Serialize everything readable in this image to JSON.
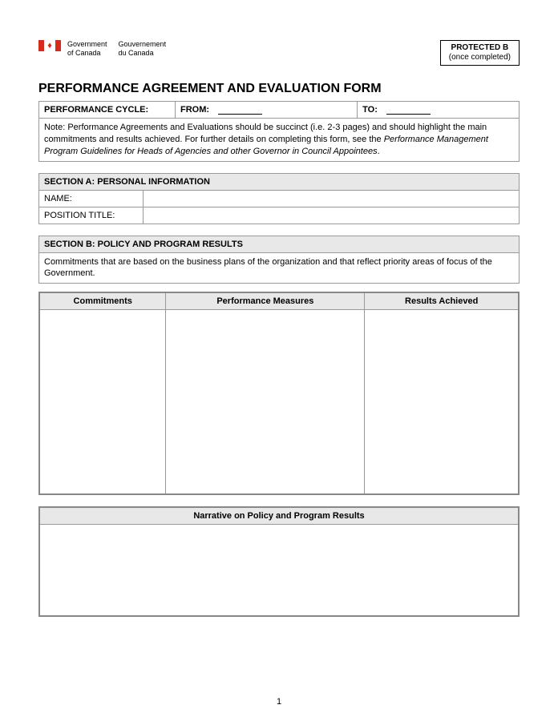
{
  "header": {
    "gov_en_line1": "Government",
    "gov_en_line2": "of Canada",
    "gov_fr_line1": "Gouvernement",
    "gov_fr_line2": "du Canada",
    "protected_line1": "PROTECTED B",
    "protected_line2": "(once completed)"
  },
  "title": "PERFORMANCE AGREEMENT AND EVALUATION FORM",
  "cycle": {
    "label": "PERFORMANCE CYCLE:",
    "from_label": "FROM:",
    "from_value": "",
    "to_label": "TO:",
    "to_value": ""
  },
  "note": {
    "prefix": "Note:  Performance Agreements and Evaluations should be succinct (i.e. 2-3 pages) and should highlight the main commitments and results achieved.  For further details on completing this form, see the ",
    "italic": "Performance Management Program Guidelines for Heads of Agencies and other Governor in Council Appointees",
    "suffix": "."
  },
  "section_a": {
    "header": "SECTION A: PERSONAL INFORMATION",
    "name_label": "NAME:",
    "name_value": "",
    "position_label": "POSITION TITLE:",
    "position_value": ""
  },
  "section_b": {
    "header": "SECTION B: POLICY AND PROGRAM RESULTS",
    "description": "Commitments that are based on the business plans of the organization and that reflect priority areas of focus of the Government.",
    "col1": "Commitments",
    "col2": "Performance Measures",
    "col3": "Results Achieved",
    "narrative_header": "Narrative on Policy and Program Results"
  },
  "page_number": "1"
}
